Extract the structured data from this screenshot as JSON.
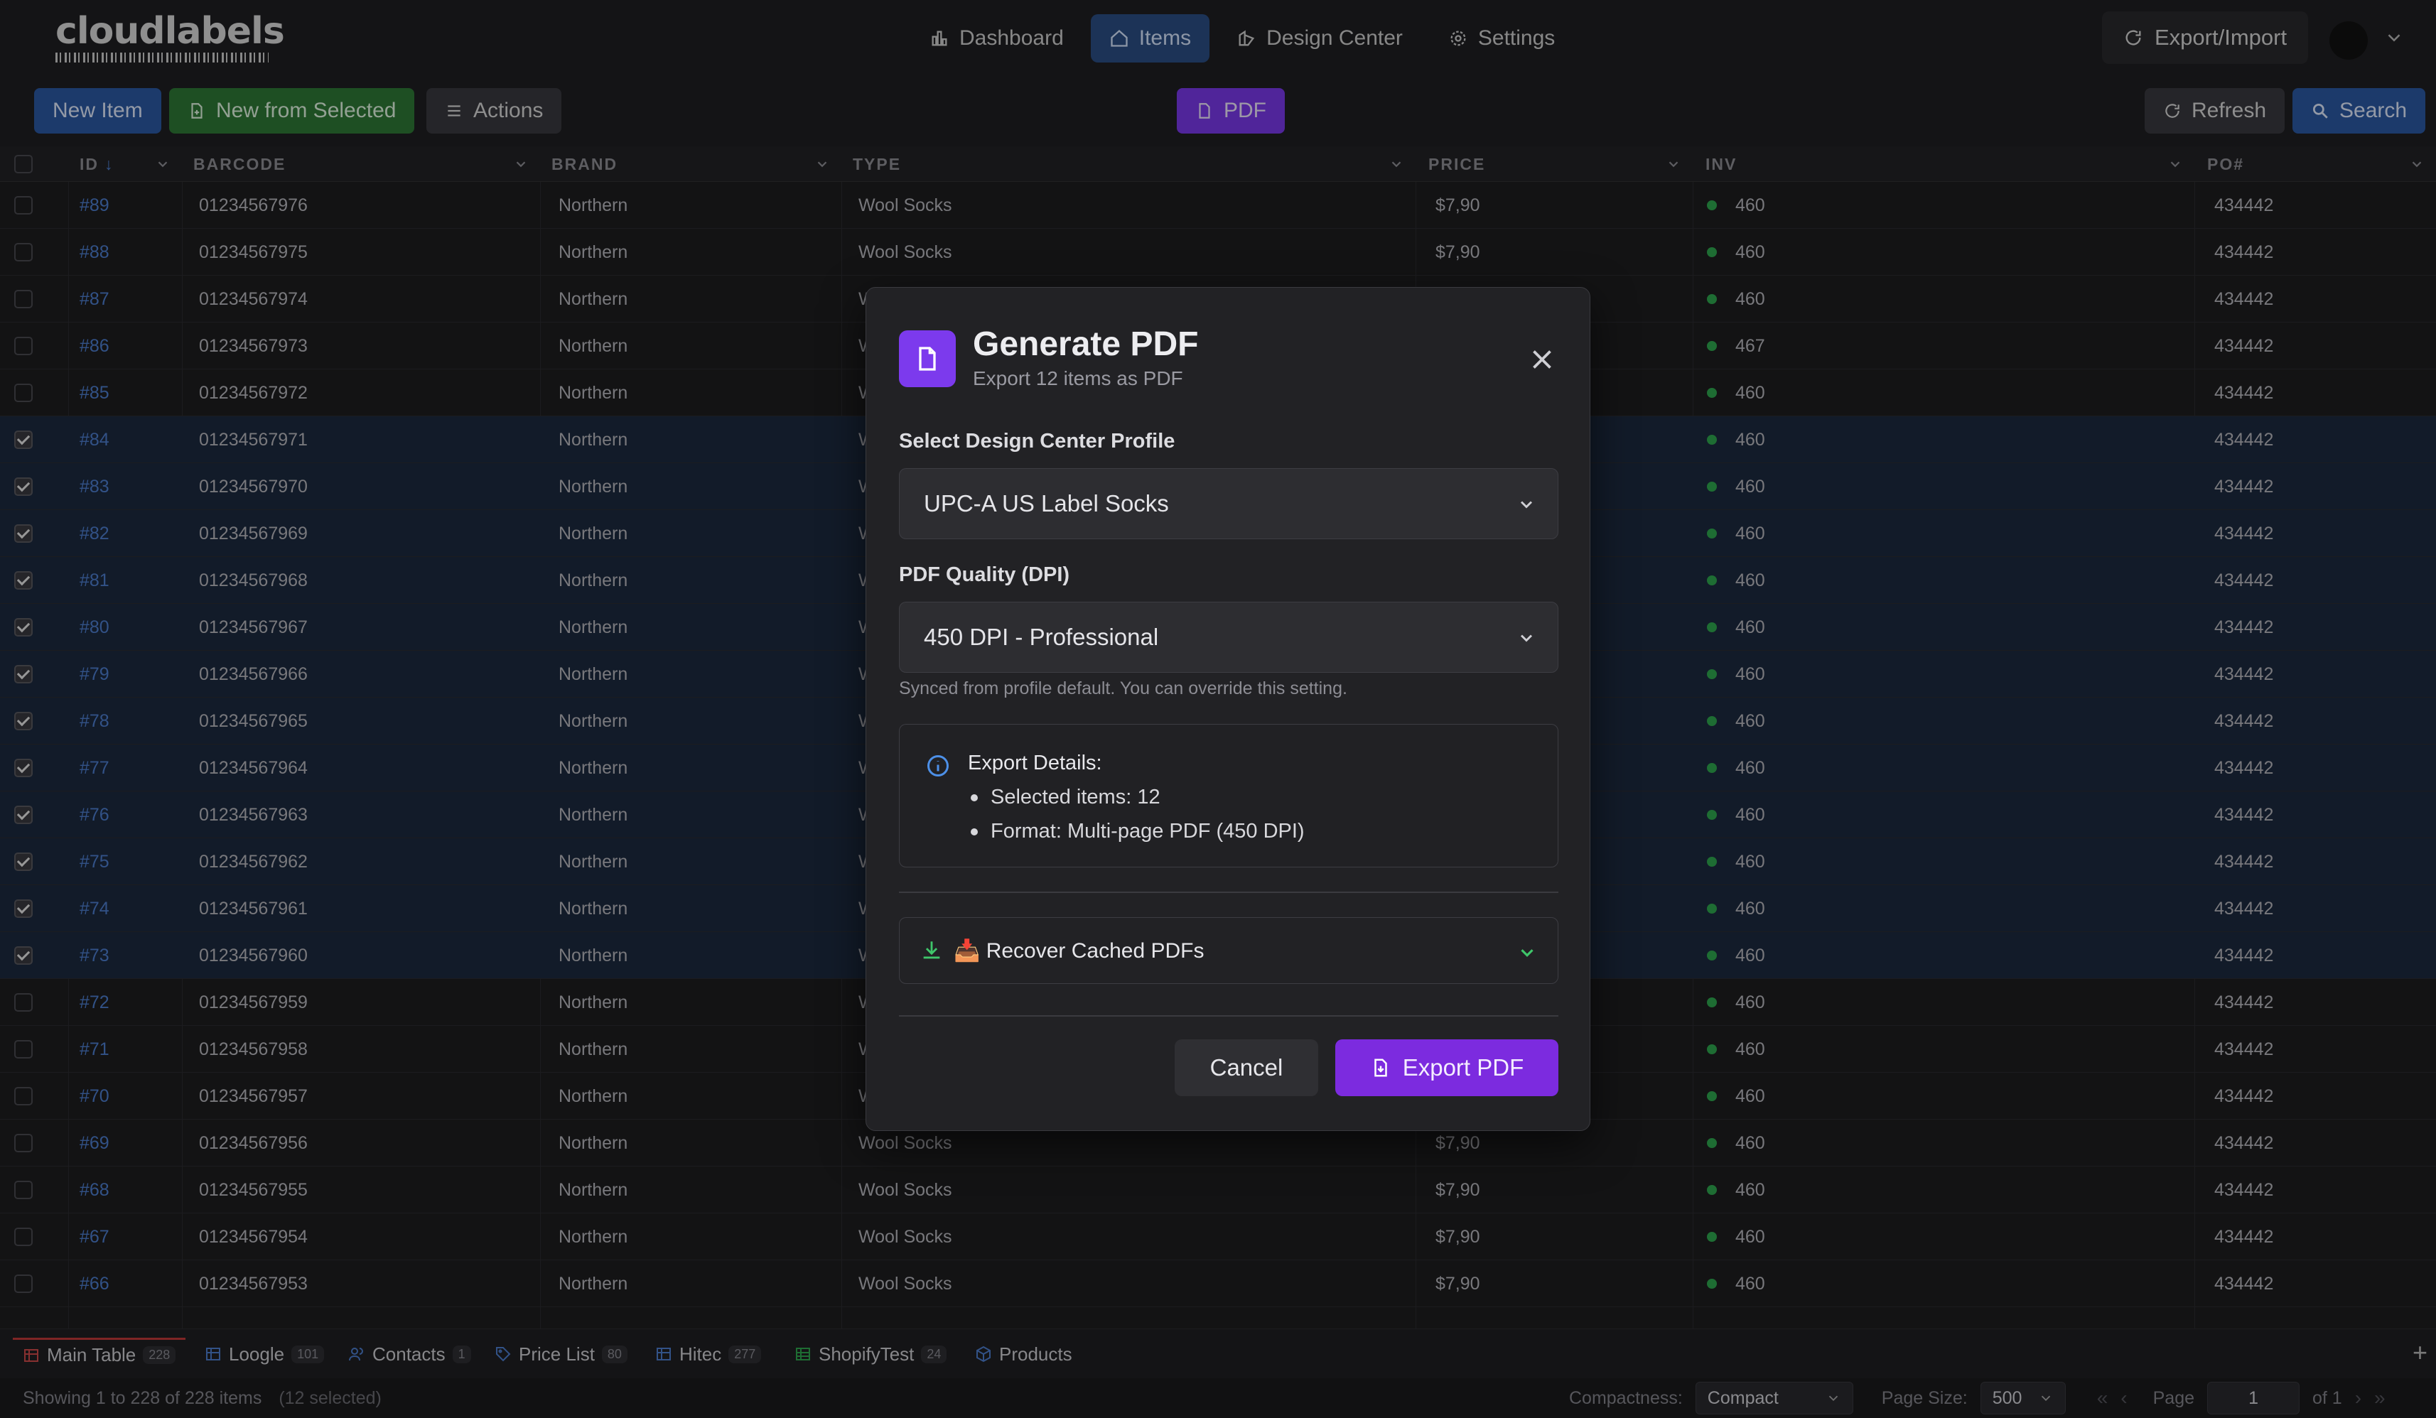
{
  "app": {
    "logo_text": "cloudlabels"
  },
  "nav": {
    "items": [
      {
        "label": "Dashboard",
        "icon": "bar-chart-icon"
      },
      {
        "label": "Items",
        "icon": "home-icon",
        "active": true
      },
      {
        "label": "Design Center",
        "icon": "design-icon"
      },
      {
        "label": "Settings",
        "icon": "gear-icon"
      }
    ],
    "export_import": "Export/Import"
  },
  "toolbar": {
    "new_item": "New Item",
    "new_from_selected": "New from Selected",
    "actions": "Actions",
    "pdf": "PDF",
    "refresh": "Refresh",
    "search": "Search"
  },
  "table": {
    "columns": [
      "ID",
      "BARCODE",
      "BRAND",
      "TYPE",
      "PRICE",
      "INV",
      "PO#"
    ],
    "rows": [
      {
        "id": "#89",
        "barcode": "01234567976",
        "brand": "Northern",
        "type": "Wool Socks",
        "price": "$7,90",
        "inv": "460",
        "po": "434442",
        "selected": false
      },
      {
        "id": "#88",
        "barcode": "01234567975",
        "brand": "Northern",
        "type": "Wool Socks",
        "price": "$7,90",
        "inv": "460",
        "po": "434442",
        "selected": false
      },
      {
        "id": "#87",
        "barcode": "01234567974",
        "brand": "Northern",
        "type": "W",
        "price": "",
        "inv": "460",
        "po": "434442",
        "selected": false
      },
      {
        "id": "#86",
        "barcode": "01234567973",
        "brand": "Northern",
        "type": "W",
        "price": "",
        "inv": "467",
        "po": "434442",
        "selected": false
      },
      {
        "id": "#85",
        "barcode": "01234567972",
        "brand": "Northern",
        "type": "W",
        "price": "",
        "inv": "460",
        "po": "434442",
        "selected": false
      },
      {
        "id": "#84",
        "barcode": "01234567971",
        "brand": "Northern",
        "type": "W",
        "price": "",
        "inv": "460",
        "po": "434442",
        "selected": true
      },
      {
        "id": "#83",
        "barcode": "01234567970",
        "brand": "Northern",
        "type": "W",
        "price": "",
        "inv": "460",
        "po": "434442",
        "selected": true
      },
      {
        "id": "#82",
        "barcode": "01234567969",
        "brand": "Northern",
        "type": "W",
        "price": "",
        "inv": "460",
        "po": "434442",
        "selected": true
      },
      {
        "id": "#81",
        "barcode": "01234567968",
        "brand": "Northern",
        "type": "W",
        "price": "",
        "inv": "460",
        "po": "434442",
        "selected": true
      },
      {
        "id": "#80",
        "barcode": "01234567967",
        "brand": "Northern",
        "type": "W",
        "price": "",
        "inv": "460",
        "po": "434442",
        "selected": true
      },
      {
        "id": "#79",
        "barcode": "01234567966",
        "brand": "Northern",
        "type": "W",
        "price": "",
        "inv": "460",
        "po": "434442",
        "selected": true
      },
      {
        "id": "#78",
        "barcode": "01234567965",
        "brand": "Northern",
        "type": "W",
        "price": "",
        "inv": "460",
        "po": "434442",
        "selected": true
      },
      {
        "id": "#77",
        "barcode": "01234567964",
        "brand": "Northern",
        "type": "W",
        "price": "",
        "inv": "460",
        "po": "434442",
        "selected": true
      },
      {
        "id": "#76",
        "barcode": "01234567963",
        "brand": "Northern",
        "type": "W",
        "price": "",
        "inv": "460",
        "po": "434442",
        "selected": true
      },
      {
        "id": "#75",
        "barcode": "01234567962",
        "brand": "Northern",
        "type": "W",
        "price": "",
        "inv": "460",
        "po": "434442",
        "selected": true
      },
      {
        "id": "#74",
        "barcode": "01234567961",
        "brand": "Northern",
        "type": "W",
        "price": "",
        "inv": "460",
        "po": "434442",
        "selected": true
      },
      {
        "id": "#73",
        "barcode": "01234567960",
        "brand": "Northern",
        "type": "W",
        "price": "",
        "inv": "460",
        "po": "434442",
        "selected": true
      },
      {
        "id": "#72",
        "barcode": "01234567959",
        "brand": "Northern",
        "type": "W",
        "price": "",
        "inv": "460",
        "po": "434442",
        "selected": false
      },
      {
        "id": "#71",
        "barcode": "01234567958",
        "brand": "Northern",
        "type": "W",
        "price": "",
        "inv": "460",
        "po": "434442",
        "selected": false
      },
      {
        "id": "#70",
        "barcode": "01234567957",
        "brand": "Northern",
        "type": "W",
        "price": "",
        "inv": "460",
        "po": "434442",
        "selected": false
      },
      {
        "id": "#69",
        "barcode": "01234567956",
        "brand": "Northern",
        "type": "Wool Socks",
        "price": "$7,90",
        "inv": "460",
        "po": "434442",
        "selected": false
      },
      {
        "id": "#68",
        "barcode": "01234567955",
        "brand": "Northern",
        "type": "Wool Socks",
        "price": "$7,90",
        "inv": "460",
        "po": "434442",
        "selected": false
      },
      {
        "id": "#67",
        "barcode": "01234567954",
        "brand": "Northern",
        "type": "Wool Socks",
        "price": "$7,90",
        "inv": "460",
        "po": "434442",
        "selected": false
      },
      {
        "id": "#66",
        "barcode": "01234567953",
        "brand": "Northern",
        "type": "Wool Socks",
        "price": "$7,90",
        "inv": "460",
        "po": "434442",
        "selected": false
      }
    ]
  },
  "sheet_tabs": [
    {
      "label": "Main Table",
      "count": "228",
      "active": true,
      "icon": "table-icon"
    },
    {
      "label": "Loogle",
      "count": "101",
      "icon": "table-icon"
    },
    {
      "label": "Contacts",
      "count": "1",
      "icon": "users-icon"
    },
    {
      "label": "Price List",
      "count": "80",
      "icon": "tag-icon"
    },
    {
      "label": "Hitec",
      "count": "277",
      "icon": "table-icon"
    },
    {
      "label": "ShopifyTest",
      "count": "24",
      "icon": "sheet-icon"
    },
    {
      "label": "Products",
      "count": "",
      "icon": "package-icon"
    }
  ],
  "status": {
    "showing": "Showing 1 to 228 of 228 items",
    "selected": "(12 selected)",
    "compactness_label": "Compactness:",
    "compactness_value": "Compact",
    "page_size_label": "Page Size:",
    "page_size_value": "500",
    "page_label": "Page",
    "page_value": "1",
    "of_label": "of 1"
  },
  "modal": {
    "title": "Generate PDF",
    "subtitle": "Export 12 items as PDF",
    "profile_label": "Select Design Center Profile",
    "profile_value": "UPC-A US Label Socks",
    "quality_label": "PDF Quality (DPI)",
    "quality_value": "450 DPI - Professional",
    "hint": "Synced from profile default. You can override this setting.",
    "details_title": "Export Details:",
    "details_items": [
      "Selected items: 12",
      "Format: Multi-page PDF (450 DPI)"
    ],
    "recover_label": "📥 Recover Cached PDFs",
    "cancel": "Cancel",
    "export": "Export PDF"
  },
  "colors": {
    "accent_purple": "#7c3aed",
    "accent_blue": "#2b5aa5",
    "accent_green": "#2e7a36",
    "status_green": "#2fa84f"
  }
}
